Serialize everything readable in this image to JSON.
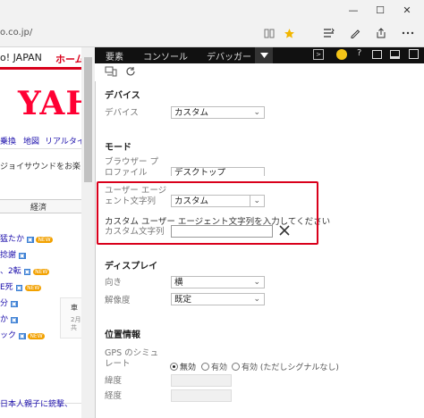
{
  "browser": {
    "url": "o.co.jp/",
    "window_buttons": {
      "minimize": "—",
      "maximize": "☐",
      "close": "✕"
    },
    "toolbar_icons": [
      "reading-view-icon",
      "favorite-star-icon",
      "hub-icon",
      "notes-icon",
      "share-icon",
      "more-icon"
    ],
    "star_color": "#f2b600"
  },
  "webpage": {
    "title": "o! JAPAN",
    "home": "ホーム",
    "logo": "YAH",
    "nav1": "乗換",
    "nav2": "地図",
    "nav3": "リアルタイ",
    "notice": "ジョイサウンドをお楽に",
    "tab": "経済",
    "items": [
      {
        "text": "猛たか",
        "badge": "NEW"
      },
      {
        "text": "捻謝",
        "badge": ""
      },
      {
        "text": "、2転",
        "badge": "NEW"
      },
      {
        "text": "E死",
        "badge": "NEW"
      },
      {
        "text": "分",
        "badge": ""
      },
      {
        "text": "か",
        "badge": ""
      },
      {
        "text": "ック",
        "badge": "NEW"
      }
    ],
    "side_text1": "車",
    "side_text2": "2月",
    "side_text3": "共",
    "bottom": "日本人親子に銃撃、",
    "badge_color": "#f2a100",
    "link_color": "#1a0dab"
  },
  "devtools": {
    "tabs": [
      "要素",
      "コンソール",
      "デバッガー"
    ],
    "tools": [
      "emulation-icon",
      "refresh-icon"
    ],
    "sections": {
      "device": {
        "title": "デバイス",
        "device_label": "デバイス",
        "device_value": "カスタム"
      },
      "mode": {
        "title": "モード",
        "profile_label": "ブラウザー プロファイル",
        "profile_value": "デスクトップ",
        "ua_label": "ユーザー エージェント文字列",
        "ua_value": "カスタム",
        "custom_prompt": "カスタム ユーザー エージェント文字列を入力してください",
        "custom_label": "カスタム文字列",
        "custom_value": ""
      },
      "display": {
        "title": "ディスプレイ",
        "orientation_label": "向き",
        "orientation_value": "横",
        "resolution_label": "解像度",
        "resolution_value": "既定"
      },
      "geo": {
        "title": "位置情報",
        "gps_label": "GPS のシミュレート",
        "opt_off": "無効",
        "opt_on": "有効",
        "opt_no_signal": "有効 (ただしシグナルなし)",
        "lat_label": "緯度",
        "lon_label": "経度"
      }
    },
    "highlight_color": "#d9001b"
  }
}
